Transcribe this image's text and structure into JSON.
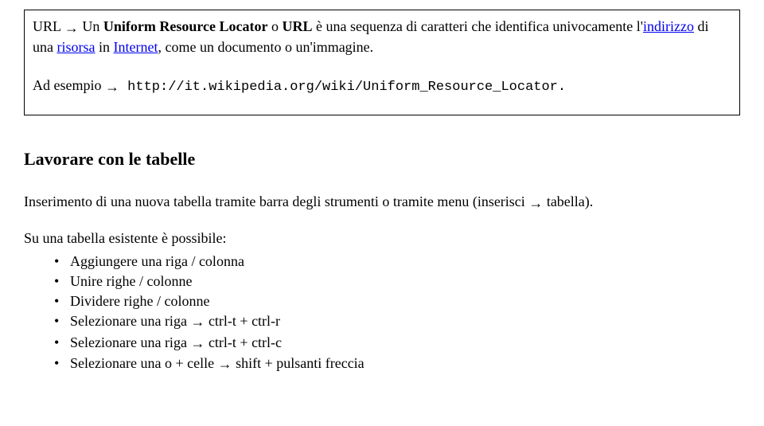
{
  "box": {
    "term": "URL",
    "arrow": "→",
    "def_1": "Un ",
    "def_bold": "Uniform Resource Locator",
    "def_2": " o ",
    "def_abbr": "URL",
    "def_3": " è una sequenza di caratteri che identifica univocamente l'",
    "link1": "indirizzo",
    "def_4": " di una ",
    "link2": "risorsa",
    "def_5": " in ",
    "link3": "Internet",
    "def_6": ", come un documento o un'immagine.",
    "example_label": "Ad esempio",
    "example_arrow": "→",
    "example_url": " http://it.wikipedia.org/wiki/Uniform_Resource_Locator."
  },
  "section": {
    "heading": "Lavorare con le tabelle",
    "intro_1": "Inserimento di una nuova tabella tramite barra degli strumenti o tramite menu (inserisci ",
    "intro_arrow": "→",
    "intro_2": " tabella).",
    "list_intro": "Su una tabella esistente è possibile:",
    "items": [
      {
        "text": "Aggiungere una riga / colonna"
      },
      {
        "text": "Unire righe / colonne"
      },
      {
        "text": "Dividere righe / colonne"
      },
      {
        "pre": "Selezionare una riga ",
        "arrow": "→",
        "post": " ctrl-t + ctrl-r"
      },
      {
        "pre": "Selezionare una riga ",
        "arrow": "→",
        "post": " ctrl-t + ctrl-c"
      },
      {
        "pre": "Selezionare una o + celle ",
        "arrow": "→",
        "post": " shift + pulsanti freccia"
      }
    ]
  }
}
